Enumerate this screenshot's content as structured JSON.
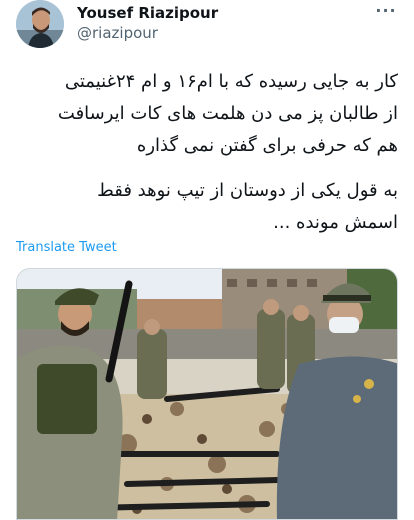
{
  "author": {
    "name": "Yousef Riazipour",
    "handle": "@riazipour"
  },
  "tweet": {
    "lines": [
      "کار به جایی رسیده که با ام۱۶ و ام ۲۴غنیمتی",
      "از طالبان پز می دن هلمت های کات ایرسافت",
      "هم که حرفی برای گفتن نمی گذاره"
    ],
    "lines2": [
      "به قول یکی از دوستان از تیپ نوهد فقط",
      "اسمش مونده ..."
    ]
  },
  "actions": {
    "translate_label": "Translate Tweet",
    "more_label": "···"
  },
  "icons": {
    "more": "more-horizontal-icon",
    "avatar": "profile-avatar"
  },
  "colors": {
    "link": "#1d9bf0",
    "secondary_text": "#536471",
    "primary_text": "#0f1419"
  }
}
